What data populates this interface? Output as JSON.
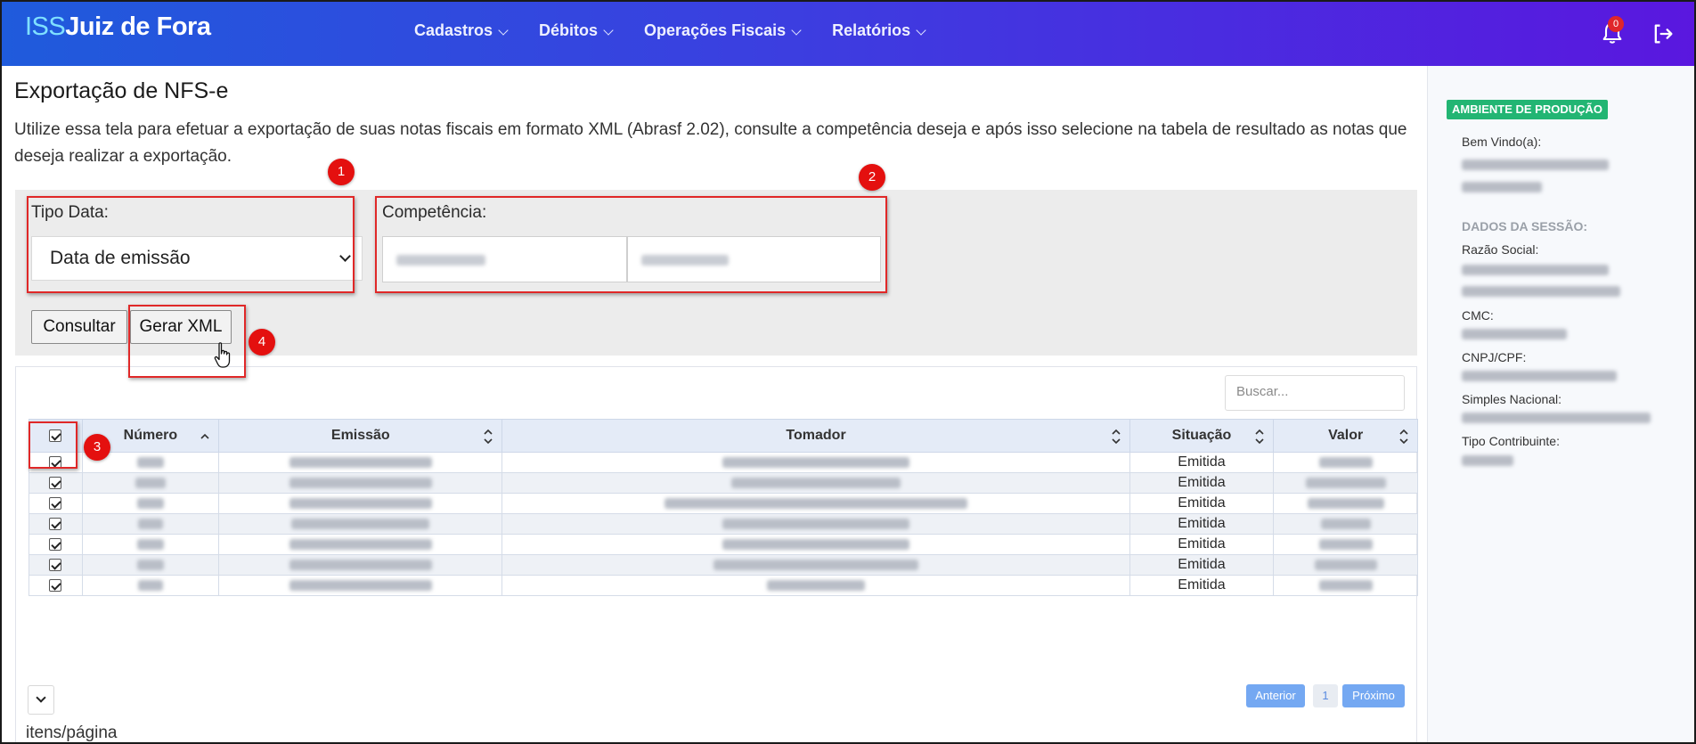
{
  "navbar": {
    "brand_prefix": "ISS",
    "brand_city": "Juiz de Fora",
    "menu": [
      {
        "label": "Cadastros"
      },
      {
        "label": "Débitos"
      },
      {
        "label": "Operações Fiscais"
      },
      {
        "label": "Relatórios"
      }
    ],
    "notification_count": "0",
    "icons": {
      "bell": "bell-icon",
      "logout": "logout-icon"
    }
  },
  "page": {
    "title": "Exportação de NFS-e",
    "description": "Utilize essa tela para efetuar a exportação de suas notas fiscais em formato XML (Abrasf 2.02), consulte a competência deseja e após isso selecione na tabela de resultado as notas que deseja realizar a exportação."
  },
  "filters": {
    "tipo_data_label": "Tipo Data:",
    "tipo_data_value": "Data de emissão",
    "competencia_label": "Competência:",
    "consultar_label": "Consultar",
    "gerar_xml_label": "Gerar XML"
  },
  "annotations": [
    "1",
    "2",
    "3",
    "4"
  ],
  "table": {
    "search_placeholder": "Buscar...",
    "columns": [
      "Número",
      "Emissão",
      "Tomador",
      "Situação",
      "Valor"
    ],
    "rows": [
      {
        "checked": true,
        "situacao": "Emitida"
      },
      {
        "checked": true,
        "situacao": "Emitida"
      },
      {
        "checked": true,
        "situacao": "Emitida"
      },
      {
        "checked": true,
        "situacao": "Emitida"
      },
      {
        "checked": true,
        "situacao": "Emitida"
      },
      {
        "checked": true,
        "situacao": "Emitida"
      },
      {
        "checked": true,
        "situacao": "Emitida"
      }
    ],
    "per_page_label": "itens/página",
    "pagination": {
      "prev": "Anterior",
      "page": "1",
      "next": "Próximo"
    }
  },
  "sidebar": {
    "env_badge": "AMBIENTE DE PRODUÇÃO",
    "welcome_label": "Bem Vindo(a):",
    "session_header": "DADOS DA SESSÃO:",
    "razao_social_label": "Razão Social:",
    "cmc_label": "CMC:",
    "cnpj_label": "CNPJ/CPF:",
    "simples_label": "Simples Nacional:",
    "tipo_contribuinte_label": "Tipo Contribuinte:"
  },
  "colors": {
    "navbar_start": "#1f5bdc",
    "navbar_end": "#5a17df",
    "annotation_red": "#e4100f",
    "env_green": "#22b573",
    "pagination_blue": "#74a8f2"
  }
}
